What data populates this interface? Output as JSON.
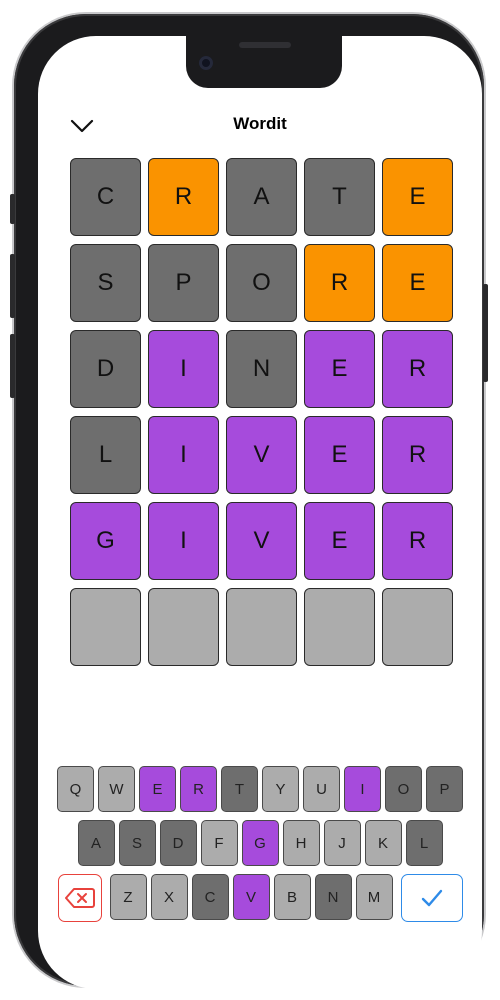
{
  "header": {
    "title": "Wordit",
    "back_icon": "chevron-down-icon"
  },
  "colors": {
    "absent": "#6e6e6e",
    "present": "#fa9300",
    "correct": "#a64bdc",
    "empty": "#acacac",
    "delete_border": "#e8423c",
    "submit_border": "#2e8be8"
  },
  "board": [
    [
      {
        "letter": "C",
        "state": "absent"
      },
      {
        "letter": "R",
        "state": "present"
      },
      {
        "letter": "A",
        "state": "absent"
      },
      {
        "letter": "T",
        "state": "absent"
      },
      {
        "letter": "E",
        "state": "present"
      }
    ],
    [
      {
        "letter": "S",
        "state": "absent"
      },
      {
        "letter": "P",
        "state": "absent"
      },
      {
        "letter": "O",
        "state": "absent"
      },
      {
        "letter": "R",
        "state": "present"
      },
      {
        "letter": "E",
        "state": "present"
      }
    ],
    [
      {
        "letter": "D",
        "state": "absent"
      },
      {
        "letter": "I",
        "state": "correct"
      },
      {
        "letter": "N",
        "state": "absent"
      },
      {
        "letter": "E",
        "state": "correct"
      },
      {
        "letter": "R",
        "state": "correct"
      }
    ],
    [
      {
        "letter": "L",
        "state": "absent"
      },
      {
        "letter": "I",
        "state": "correct"
      },
      {
        "letter": "V",
        "state": "correct"
      },
      {
        "letter": "E",
        "state": "correct"
      },
      {
        "letter": "R",
        "state": "correct"
      }
    ],
    [
      {
        "letter": "G",
        "state": "correct"
      },
      {
        "letter": "I",
        "state": "correct"
      },
      {
        "letter": "V",
        "state": "correct"
      },
      {
        "letter": "E",
        "state": "correct"
      },
      {
        "letter": "R",
        "state": "correct"
      }
    ],
    [
      {
        "letter": "",
        "state": "empty"
      },
      {
        "letter": "",
        "state": "empty"
      },
      {
        "letter": "",
        "state": "empty"
      },
      {
        "letter": "",
        "state": "empty"
      },
      {
        "letter": "",
        "state": "empty"
      }
    ]
  ],
  "keyboard": {
    "rows": [
      [
        {
          "label": "Q",
          "state": "unused"
        },
        {
          "label": "W",
          "state": "unused"
        },
        {
          "label": "E",
          "state": "correct"
        },
        {
          "label": "R",
          "state": "correct"
        },
        {
          "label": "T",
          "state": "absent"
        },
        {
          "label": "Y",
          "state": "unused"
        },
        {
          "label": "U",
          "state": "unused"
        },
        {
          "label": "I",
          "state": "correct"
        },
        {
          "label": "O",
          "state": "absent"
        },
        {
          "label": "P",
          "state": "absent"
        }
      ],
      [
        {
          "label": "A",
          "state": "absent"
        },
        {
          "label": "S",
          "state": "absent"
        },
        {
          "label": "D",
          "state": "absent"
        },
        {
          "label": "F",
          "state": "unused"
        },
        {
          "label": "G",
          "state": "correct"
        },
        {
          "label": "H",
          "state": "unused"
        },
        {
          "label": "J",
          "state": "unused"
        },
        {
          "label": "K",
          "state": "unused"
        },
        {
          "label": "L",
          "state": "absent"
        }
      ],
      [
        {
          "label": "Z",
          "state": "unused"
        },
        {
          "label": "X",
          "state": "unused"
        },
        {
          "label": "C",
          "state": "absent"
        },
        {
          "label": "V",
          "state": "correct"
        },
        {
          "label": "B",
          "state": "unused"
        },
        {
          "label": "N",
          "state": "absent"
        },
        {
          "label": "M",
          "state": "unused"
        }
      ]
    ],
    "delete_icon": "backspace-icon",
    "submit_icon": "checkmark-icon"
  }
}
